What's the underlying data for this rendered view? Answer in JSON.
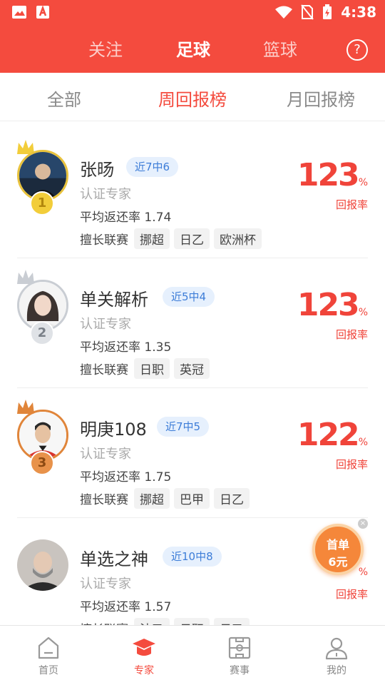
{
  "status_bar": {
    "time": "4:38"
  },
  "top_tabs": {
    "follow": "关注",
    "football": "足球",
    "basketball": "篮球",
    "help": "?"
  },
  "sub_tabs": {
    "all": "全部",
    "weekly": "周回报榜",
    "monthly": "月回报榜"
  },
  "colors": {
    "brand": "#f44b3e",
    "streak_bg": "#e6f0fd",
    "streak_text": "#3d7dd8",
    "gold": "#e8c23c",
    "silver": "#c9cdd3",
    "bronze": "#e0853a",
    "promo": "#f5873a"
  },
  "experts": [
    {
      "name": "张旸",
      "streak": "近7中6",
      "cert": "认证专家",
      "avg_label": "平均返还率",
      "avg": "1.74",
      "leagues_label": "擅长联赛",
      "leagues": [
        "挪超",
        "日乙",
        "欧洲杯"
      ],
      "rate": "123",
      "rate_unit": "%",
      "rate_label": "回报率",
      "rank": "1"
    },
    {
      "name": "单关解析",
      "streak": "近5中4",
      "cert": "认证专家",
      "avg_label": "平均返还率",
      "avg": "1.35",
      "leagues_label": "擅长联赛",
      "leagues": [
        "日职",
        "英冠"
      ],
      "rate": "123",
      "rate_unit": "%",
      "rate_label": "回报率",
      "rank": "2"
    },
    {
      "name": "明庚108",
      "streak": "近7中5",
      "cert": "认证专家",
      "avg_label": "平均返还率",
      "avg": "1.75",
      "leagues_label": "擅长联赛",
      "leagues": [
        "挪超",
        "巴甲",
        "日乙"
      ],
      "rate": "122",
      "rate_unit": "%",
      "rate_label": "回报率",
      "rank": "3"
    },
    {
      "name": "单选之神",
      "streak": "近10中8",
      "cert": "认证专家",
      "avg_label": "平均返还率",
      "avg": "1.57",
      "leagues_label": "擅长联赛",
      "leagues": [
        "法乙",
        "日职",
        "日乙"
      ],
      "rate": "",
      "rate_unit": "%",
      "rate_label": "回报率",
      "rank": ""
    }
  ],
  "promo": {
    "line1": "首单",
    "line2": "6元"
  },
  "bottom_nav": [
    {
      "label": "首页",
      "icon": "home-icon"
    },
    {
      "label": "专家",
      "icon": "expert-cap-icon"
    },
    {
      "label": "赛事",
      "icon": "field-icon"
    },
    {
      "label": "我的",
      "icon": "profile-icon"
    }
  ]
}
